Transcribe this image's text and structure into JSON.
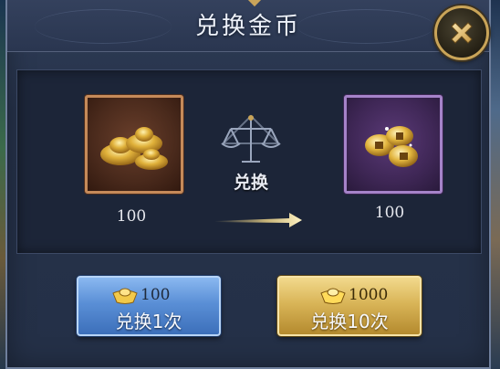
{
  "dialog": {
    "title": "兑换金币",
    "close_icon": "close-x-icon"
  },
  "exchange": {
    "label": "兑换",
    "source": {
      "icon": "gold-ingot-icon",
      "amount": "100"
    },
    "target": {
      "icon": "gold-coins-icon",
      "amount": "100"
    },
    "scale_icon": "balance-scale-icon",
    "arrow_icon": "arrow-right-icon"
  },
  "buttons": [
    {
      "cost": "100",
      "label": "兑换1次",
      "cost_icon": "gold-ingot-icon",
      "color": "#5a8fd6"
    },
    {
      "cost": "1000",
      "label": "兑换10次",
      "cost_icon": "gold-ingot-icon",
      "color": "#d9b558"
    }
  ],
  "colors": {
    "panel_bg": "#26324a",
    "gold_accent": "#c9a458",
    "source_frame": "#c58a59",
    "target_frame": "#a583c9"
  }
}
